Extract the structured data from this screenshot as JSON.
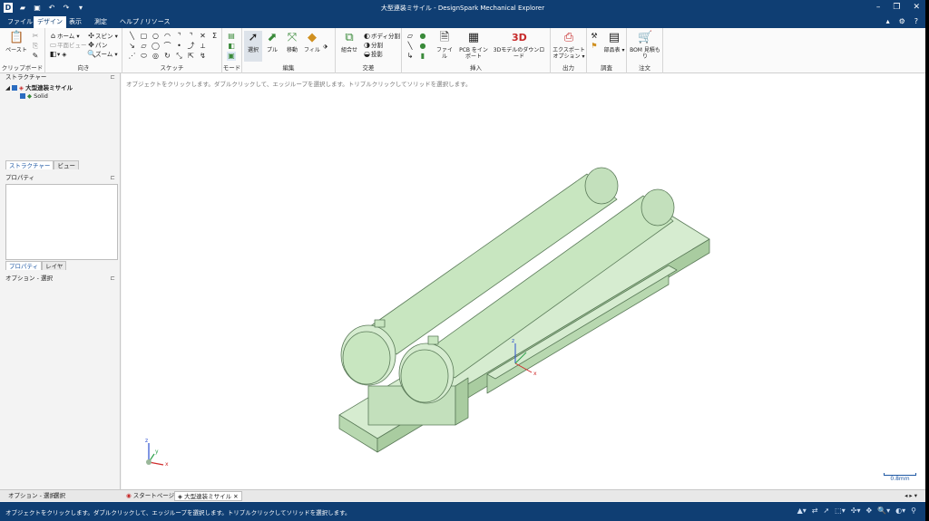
{
  "window": {
    "title": "大型連装ミサイル - DesignSpark  Mechanical  Explorer",
    "qat_icons": [
      "app-logo-icon",
      "open-folder-icon",
      "save-icon",
      "undo-icon",
      "redo-icon",
      "customize-icon"
    ]
  },
  "menu": {
    "tabs": [
      "ファイル",
      "デザイン",
      "表示",
      "測定",
      "ヘルプ / リソース"
    ],
    "active_tab": "デザイン"
  },
  "ribbon": {
    "clipboard": {
      "label": "クリップボード",
      "paste": "ペースト"
    },
    "orient": {
      "label": "向き",
      "home": "ホーム",
      "plane_view": "平面ビュー",
      "spin": "スピン",
      "pan": "パン",
      "zoom": "ズーム"
    },
    "sketch": {
      "label": "スケッチ"
    },
    "mode": {
      "label": "モード"
    },
    "edit": {
      "label": "編集",
      "select": "選択",
      "pull": "プル",
      "move": "移動",
      "fill": "フィル"
    },
    "intersect": {
      "label": "交差",
      "combine": "組合せ",
      "split_body": "ボディ分割",
      "split": "分割",
      "project": "投影"
    },
    "insert": {
      "label": "挿入",
      "file": "ファイル",
      "pcb_import": "PCB をインポート",
      "model_download": "3Dモデルのダウンロード"
    },
    "output": {
      "label": "出力",
      "export_options": "エクスポートオプション"
    },
    "inspect": {
      "label": "調査",
      "parts_table": "部品表"
    },
    "order": {
      "label": "注文",
      "bom_quote": "BOM 見積もり"
    }
  },
  "structure_panel": {
    "title": "ストラクチャー",
    "root": "大型連装ミサイル",
    "child": "Solid",
    "tabs": [
      "ストラクチャー",
      "ビュー"
    ]
  },
  "properties_panel": {
    "title": "プロパティ",
    "tabs": [
      "プロパティ",
      "レイヤ"
    ]
  },
  "options_panel": {
    "title": "オプション - 選択"
  },
  "viewport": {
    "hint": "オブジェクトをクリックします。ダブルクリックして、エッジループを選択します。トリプルクリックしてソリッドを選択します。",
    "scale": "0.8mm",
    "model_color": "#c8e6c0",
    "axes": {
      "x": "x",
      "y": "y",
      "z": "z"
    }
  },
  "bottom_tabs": {
    "left": [
      "オプション - 選択",
      "選択"
    ],
    "docs": [
      "スタートページ",
      "大型連装ミサイル"
    ]
  },
  "status": {
    "message": "オブジェクトをクリックします。ダブルクリックして、エッジループを選択します。トリプルクリックしてソリッドを選択します。"
  },
  "colors": {
    "titlebar": "#0f3e73",
    "accent": "#1d57a3",
    "model": "#c8e6c0"
  }
}
